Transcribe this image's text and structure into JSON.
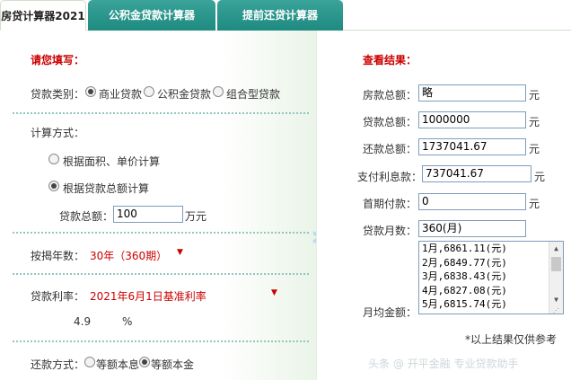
{
  "tabs": [
    {
      "label": "房贷计算器2021"
    },
    {
      "label": "公积金贷款计算器"
    },
    {
      "label": "提前还贷计算器"
    }
  ],
  "form": {
    "header": "请您填写：",
    "loan_type_label": "贷款类别：",
    "loan_type_options": [
      "商业贷款",
      "公积金贷款",
      "组合型贷款"
    ],
    "loan_type_selected": "商业贷款",
    "calc_method_label": "计算方式：",
    "calc_method_options": [
      "根据面积、单价计算",
      "根据贷款总额计算"
    ],
    "calc_method_selected": "根据贷款总额计算",
    "loan_total_label": "贷款总额：",
    "loan_total_value": "100",
    "loan_total_unit": "万元",
    "years_label": "按揭年数：",
    "years_value": "30年（360期）",
    "rate_label": "贷款利率：",
    "rate_value": "2021年6月1日基准利率",
    "rate_number": "4.9",
    "rate_unit": "%",
    "repay_method_label": "还款方式：",
    "repay_method_options": [
      "等额本息",
      "等额本金"
    ],
    "repay_method_selected": "等额本金"
  },
  "results": {
    "header": "查看结果：",
    "house_total_label": "房款总额：",
    "house_total_value": "略",
    "loan_total_label": "贷款总额：",
    "loan_total_value": "1000000",
    "repay_total_label": "还款总额：",
    "repay_total_value": "1737041.67",
    "interest_label": "支付利息款：",
    "interest_value": "737041.67",
    "down_payment_label": "首期付款：",
    "down_payment_value": "0",
    "months_label": "贷款月数：",
    "months_value": "360(月)",
    "monthly_label": "月均金额：",
    "monthly_list": [
      "1月,6861.11(元)",
      "2月,6849.77(元)",
      "3月,6838.43(元)",
      "4月,6827.08(元)",
      "5月,6815.74(元)"
    ],
    "unit": "元",
    "disclaimer": "*以上结果仅供参考"
  },
  "colors": {
    "accent_red": "#cc0000",
    "tab_teal": "#1e8a80",
    "separator": "#8fc7c0"
  },
  "watermark": "头条 @ 开平金融 专业贷款助手"
}
